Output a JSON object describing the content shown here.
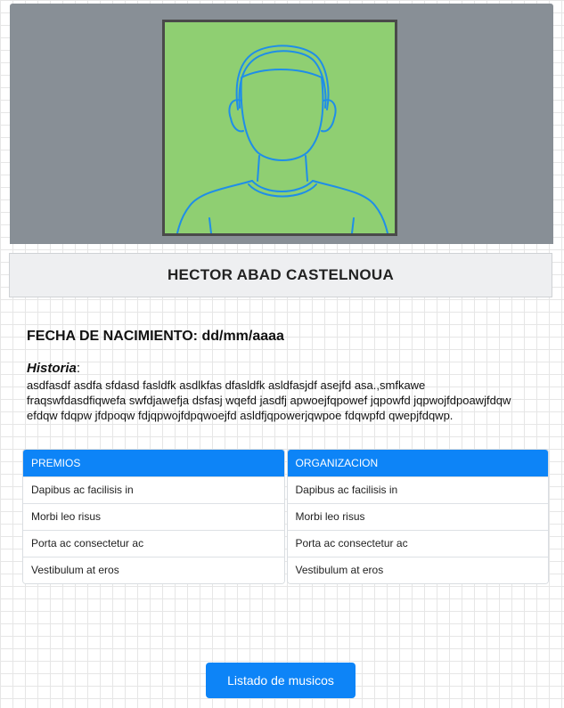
{
  "profile": {
    "name": "HECTOR ABAD CASTELNOUA",
    "birth_label": "FECHA DE NACIMIENTO: dd/mm/aaaa",
    "history_title": "Historia",
    "history_colon": ":",
    "history_text": "asdfasdf asdfa sfdasd fasldfk asdlkfas dfasldfk asldfasjdf asejfd asa.,smfkawe fraqswfdasdfiqwefa swfdjawefja dsfasj wqefd jasdfj apwoejfqpowef jqpowfd jqpwojfdpoawjfdqw efdqw fdqpw jfdpoqw fdjqpwojfdpqwoejfd asldfjqpowerjqwpoe fdqwpfd qwepjfdqwp."
  },
  "photo": {
    "icon": "person-placeholder-icon",
    "bg_color": "#8fcf72",
    "line_color": "#1f8ee8"
  },
  "awards": {
    "header": "PREMIOS",
    "items": [
      "Dapibus ac facilisis in",
      "Morbi leo risus",
      "Porta ac consectetur ac",
      "Vestibulum at eros"
    ]
  },
  "organization": {
    "header": "ORGANIZACION",
    "items": [
      "Dapibus ac facilisis in",
      "Morbi leo risus",
      "Porta ac consectetur ac",
      "Vestibulum at eros"
    ]
  },
  "actions": {
    "list_musicians_label": "Listado de musicos"
  },
  "colors": {
    "accent": "#0d84f7",
    "hero_bg": "#888f96"
  }
}
